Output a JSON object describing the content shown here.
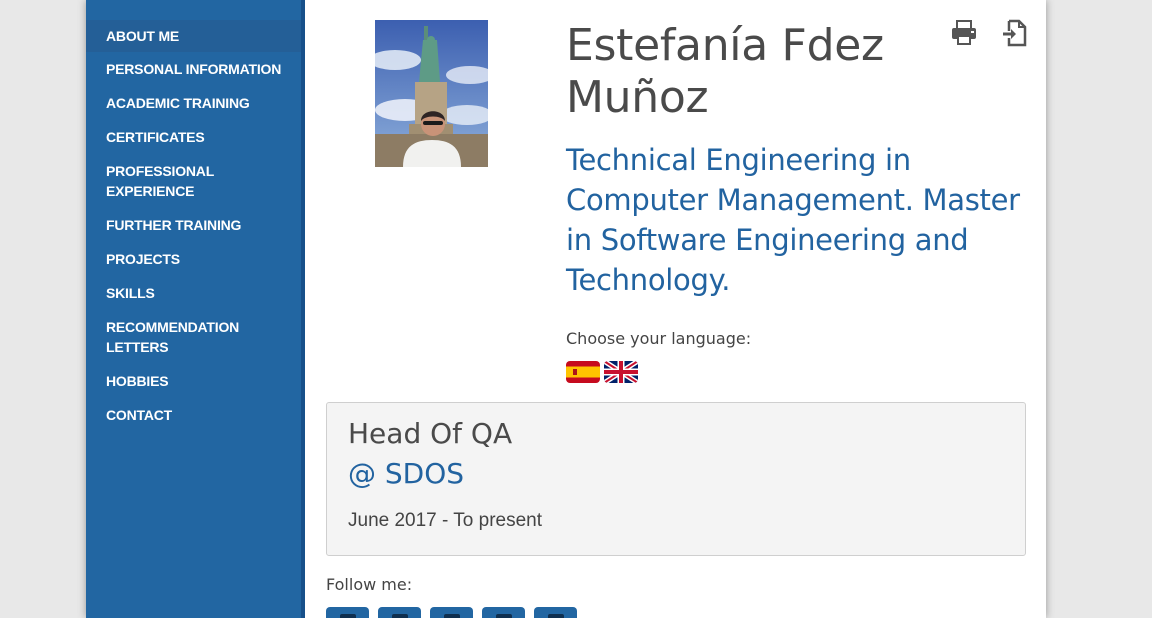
{
  "sidebar": {
    "items": [
      {
        "label": "ABOUT ME"
      },
      {
        "label": "PERSONAL INFORMATION"
      },
      {
        "label": "ACADEMIC TRAINING"
      },
      {
        "label": "CERTIFICATES"
      },
      {
        "label": "PROFESSIONAL EXPERIENCE"
      },
      {
        "label": "FURTHER TRAINING"
      },
      {
        "label": "PROJECTS"
      },
      {
        "label": "SKILLS"
      },
      {
        "label": "RECOMMENDATION LETTERS"
      },
      {
        "label": "HOBBIES"
      },
      {
        "label": "CONTACT"
      }
    ],
    "active_index": 0
  },
  "profile": {
    "name": "Estefanía Fdez Muñoz",
    "subtitle": "Technical Engineering in Computer Management. Master in Software Engineering and Technology."
  },
  "toolbar": {
    "icons": [
      "print-icon",
      "export-icon"
    ]
  },
  "language": {
    "label": "Choose your language:",
    "flags": [
      "spain-flag-icon",
      "uk-flag-icon"
    ]
  },
  "job": {
    "title": "Head Of QA",
    "company": "@ SDOS",
    "dates": "June 2017 - To present"
  },
  "follow": {
    "label": "Follow me:",
    "buttons": [
      "social-icon-1",
      "social-icon-2",
      "social-icon-3",
      "social-icon-4",
      "social-icon-5"
    ]
  },
  "colors": {
    "sidebar": "#2266a2",
    "accent": "#2263a0",
    "text": "#4a4a4a",
    "background": "#e8e8e8"
  }
}
